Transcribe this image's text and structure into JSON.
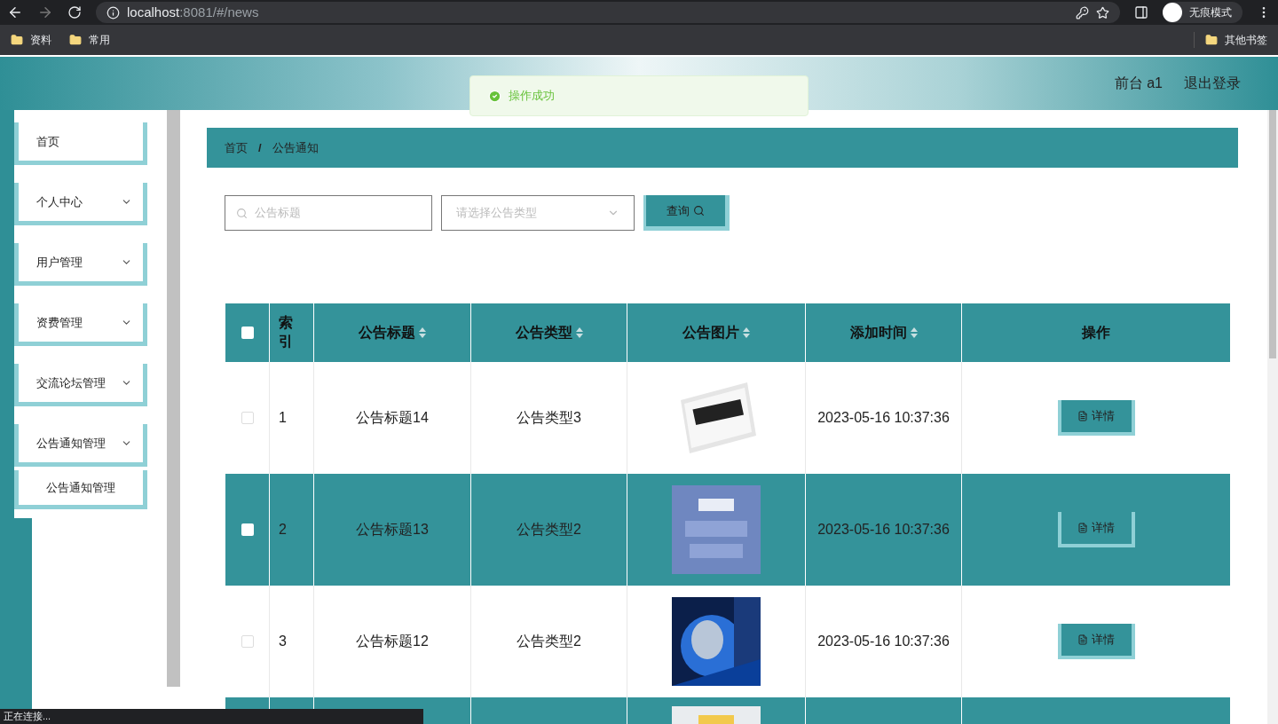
{
  "browser": {
    "url_host": "localhost",
    "url_rest": ":8081/#/news",
    "profile": "无痕模式",
    "bookmarks": [
      "资料",
      "常用"
    ],
    "other_bookmarks": "其他书签",
    "status": "正在连接..."
  },
  "header": {
    "links": [
      "前台 a1",
      "退出登录"
    ]
  },
  "toast": {
    "message": "操作成功"
  },
  "sidebar": {
    "items": [
      {
        "label": "首页",
        "kind": "link"
      },
      {
        "label": "个人中心",
        "kind": "group"
      },
      {
        "label": "用户管理",
        "kind": "group"
      },
      {
        "label": "资费管理",
        "kind": "group"
      },
      {
        "label": "交流论坛管理",
        "kind": "group"
      },
      {
        "label": "公告通知管理",
        "kind": "group",
        "expanded": true,
        "children": [
          {
            "label": "公告通知管理"
          }
        ]
      }
    ]
  },
  "breadcrumb": {
    "items": [
      "首页",
      "公告通知"
    ],
    "separator": "/"
  },
  "search": {
    "title_placeholder": "公告标题",
    "type_placeholder": "请选择公告类型",
    "button": "查询"
  },
  "table": {
    "select_all_checked": false,
    "columns": [
      {
        "label": "索引",
        "kind": "plain"
      },
      {
        "label": "公告标题",
        "kind": "sortable"
      },
      {
        "label": "公告类型",
        "kind": "sortable"
      },
      {
        "label": "公告图片",
        "kind": "sortable"
      },
      {
        "label": "添加时间",
        "kind": "sortable"
      },
      {
        "label": "操作",
        "kind": "plain"
      }
    ],
    "rows": [
      {
        "checked": false,
        "index": "1",
        "title": "公告标题14",
        "type": "公告类型3",
        "time": "2023-05-16 10:37:36",
        "action": "详情"
      },
      {
        "checked": false,
        "index": "2",
        "title": "公告标题13",
        "type": "公告类型2",
        "time": "2023-05-16 10:37:36",
        "action": "详情"
      },
      {
        "checked": false,
        "index": "3",
        "title": "公告标题12",
        "type": "公告类型2",
        "time": "2023-05-16 10:37:36",
        "action": "详情"
      }
    ]
  }
}
